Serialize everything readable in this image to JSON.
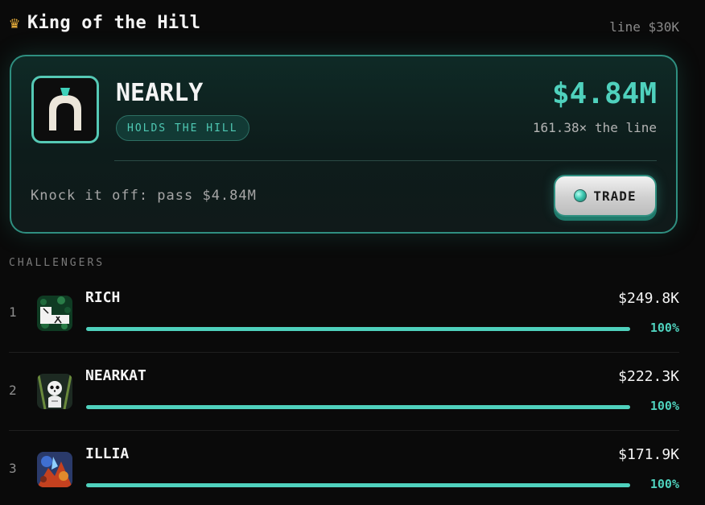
{
  "header": {
    "title": "King of the Hill",
    "crown_icon": "crown-icon",
    "line_label": "line $30K"
  },
  "king": {
    "name": "NEARLY",
    "badge": "HOLDS THE HILL",
    "market_cap": "$4.84M",
    "multiple": "161.38× the line",
    "knock_text": "Knock it off: pass $4.84M",
    "trade_label": "TRADE",
    "accent_color": "#4fd1bd"
  },
  "challengers": {
    "label": "CHALLENGERS",
    "items": [
      {
        "rank": "1",
        "name": "RICH",
        "market_cap": "$249.8K",
        "progress_label": "100%",
        "progress": 1.0
      },
      {
        "rank": "2",
        "name": "NEARKAT",
        "market_cap": "$222.3K",
        "progress_label": "100%",
        "progress": 1.0
      },
      {
        "rank": "3",
        "name": "ILLIA",
        "market_cap": "$171.9K",
        "progress_label": "100%",
        "progress": 1.0
      }
    ]
  }
}
